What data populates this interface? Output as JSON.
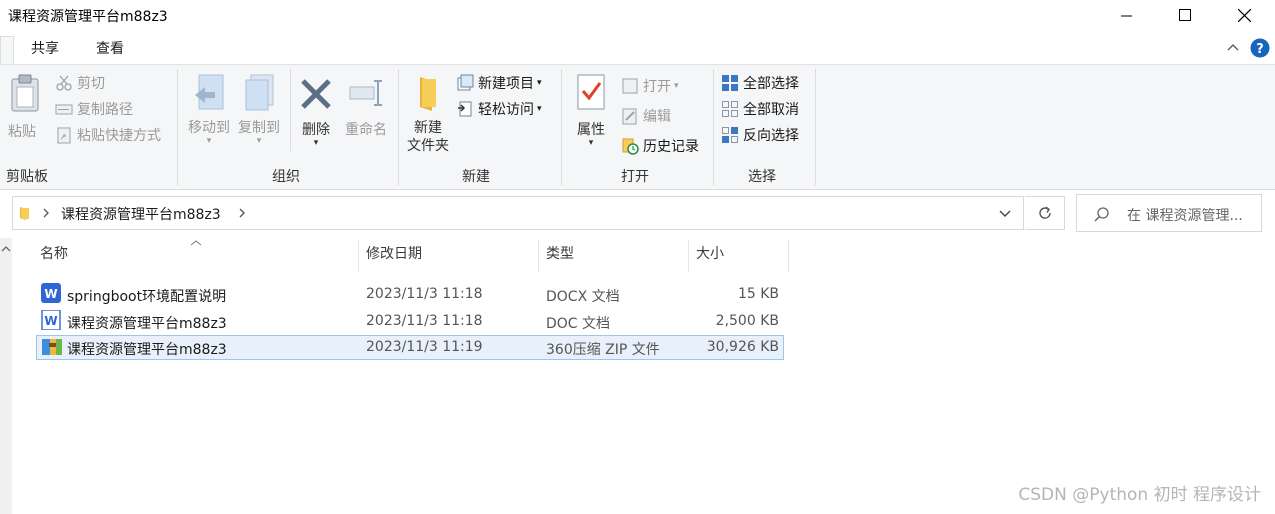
{
  "window": {
    "title": "课程资源管理平台m88z3"
  },
  "tabs": [
    {
      "label": "共享"
    },
    {
      "label": "查看"
    }
  ],
  "ribbon": {
    "clipboard": {
      "group_label": "剪贴板",
      "paste": "粘贴",
      "cut": "剪切",
      "copy_path": "复制路径",
      "paste_shortcut": "粘贴快捷方式"
    },
    "organize": {
      "group_label": "组织",
      "move_to": "移动到",
      "copy_to": "复制到",
      "delete": "删除",
      "rename": "重命名"
    },
    "new": {
      "group_label": "新建",
      "new_folder_line1": "新建",
      "new_folder_line2": "文件夹",
      "new_item": "新建项目",
      "easy_access": "轻松访问"
    },
    "open": {
      "group_label": "打开",
      "properties": "属性",
      "open": "打开",
      "edit": "编辑",
      "history": "历史记录"
    },
    "select": {
      "group_label": "选择",
      "select_all": "全部选择",
      "select_none": "全部取消",
      "invert": "反向选择"
    }
  },
  "address": {
    "path": "课程资源管理平台m88z3",
    "search_placeholder": "在 课程资源管理..."
  },
  "columns": {
    "name": "名称",
    "modified": "修改日期",
    "type": "类型",
    "size": "大小"
  },
  "files": [
    {
      "name": "springboot环境配置说明",
      "modified": "2023/11/3 11:18",
      "type": "DOCX 文档",
      "size": "15 KB",
      "icon": "wps-word-icon"
    },
    {
      "name": "课程资源管理平台m88z3",
      "modified": "2023/11/3 11:18",
      "type": "DOC 文档",
      "size": "2,500 KB",
      "icon": "word-doc-icon"
    },
    {
      "name": "课程资源管理平台m88z3",
      "modified": "2023/11/3 11:19",
      "type": "360压缩 ZIP 文件",
      "size": "30,926 KB",
      "icon": "zip-archive-icon"
    }
  ],
  "watermark": "CSDN @Python 初时 程序设计",
  "colors": {
    "accent": "#1e6fd9",
    "selection_bg": "#e8f1fb",
    "selection_border": "#99c7f0",
    "help_blue": "#1565c0"
  }
}
